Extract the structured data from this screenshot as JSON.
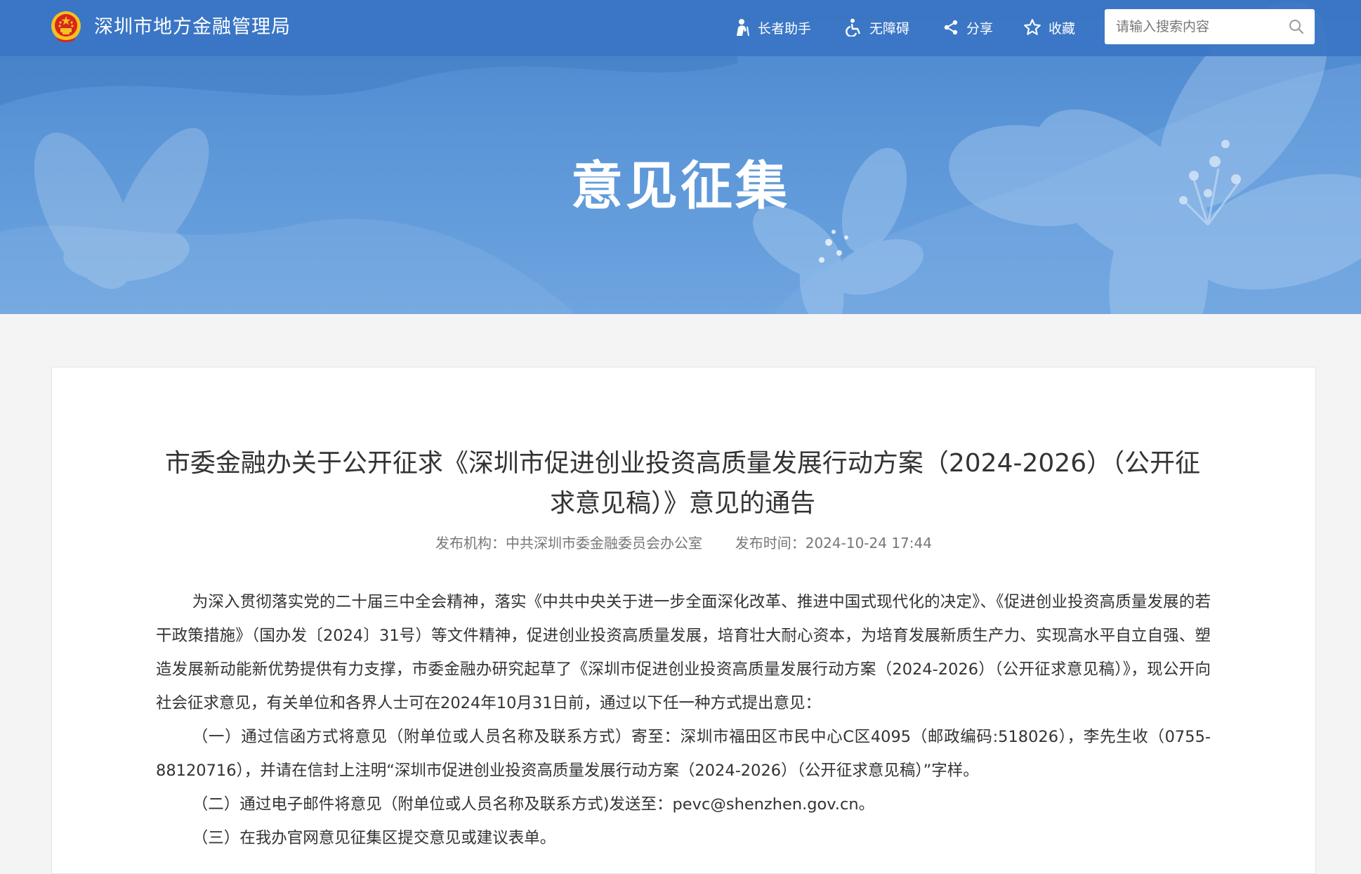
{
  "header": {
    "site_title": "深圳市地方金融管理局",
    "nav": {
      "elder_assistant": "长者助手",
      "accessibility": "无障碍",
      "share": "分享",
      "favorite": "收藏"
    },
    "search": {
      "placeholder": "请输入搜索内容",
      "value": ""
    }
  },
  "banner": {
    "title": "意见征集"
  },
  "article": {
    "title": "市委金融办关于公开征求《深圳市促进创业投资高质量发展行动方案（2024-2026）（公开征求意见稿）》意见的通告",
    "publisher_label": "发布机构：",
    "publisher": "中共深圳市委金融委员会办公室",
    "time_label": "发布时间：",
    "time": "2024-10-24 17:44",
    "paragraphs": [
      "为深入贯彻落实党的二十届三中全会精神，落实《中共中央关于进一步全面深化改革、推进中国式现代化的决定》、《促进创业投资高质量发展的若干政策措施》（国办发〔2024〕31号）等文件精神，促进创业投资高质量发展，培育壮大耐心资本，为培育发展新质生产力、实现高水平自立自强、塑造发展新动能新优势提供有力支撑，市委金融办研究起草了《深圳市促进创业投资高质量发展行动方案（2024-2026）（公开征求意见稿）》，现公开向社会征求意见，有关单位和各界人士可在2024年10月31日前，通过以下任一种方式提出意见：",
      "（一）通过信函方式将意见（附单位或人员名称及联系方式）寄至：深圳市福田区市民中心C区4095（邮政编码:518026），李先生收（0755-88120716），并请在信封上注明“深圳市促进创业投资高质量发展行动方案（2024-2026）（公开征求意见稿）”字样。",
      "（二）通过电子邮件将意见（附单位或人员名称及联系方式)发送至：pevc@shenzhen.gov.cn。",
      "（三）在我办官网意见征集区提交意见或建议表单。"
    ]
  },
  "colors": {
    "topbar": "#3a75c4",
    "banner": "#5b96d8",
    "text": "#333333",
    "meta": "#777777",
    "emblem_red": "#d7261c",
    "emblem_gold": "#f5c021"
  }
}
